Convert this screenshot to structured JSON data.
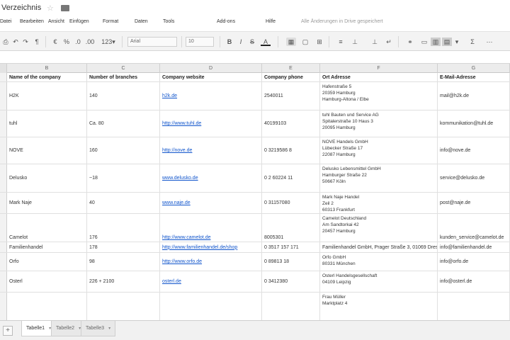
{
  "title": "Verzeichnis",
  "star_icon": "star-icon",
  "folder_icon": "folder-icon",
  "menu": [
    "Datei",
    "Bearbeiten",
    "Ansicht",
    "Einfügen",
    "Format",
    "Daten",
    "Tools",
    "Add-ons",
    "Hilfe"
  ],
  "menu_notice": "Alle Änderungen in Drive gespeichert",
  "toolbar": {
    "font": "Arial",
    "font_size": "10",
    "zoom": "100%"
  },
  "columns": [
    "B",
    "C",
    "D",
    "E",
    "F",
    "G"
  ],
  "headers": [
    "Name of the company",
    "Number of branches",
    "Company website",
    "Company phone",
    "Ort Adresse",
    "E-Mail-Adresse"
  ],
  "rows": [
    {
      "name": "H2K",
      "branches": "140",
      "website": "h2k.de",
      "phone": "2540011",
      "address": [
        "Hafenstraße 5",
        "20359 Hamburg",
        "Hamburg-Altona / Elbe"
      ],
      "email": "mail@h2k.de"
    },
    {
      "name": "tuhl",
      "branches": "Ca. 80",
      "website": "http://www.tuhl.de",
      "phone": "40199103",
      "address": [
        "tuhl Bauten und Service AG",
        "Spitalerstraße 10 Haus 3",
        "20095 Hamburg"
      ],
      "email": "kommunikation@tuhl.de"
    },
    {
      "name": "NOVE",
      "branches": "160",
      "website": "http://nove.de",
      "phone": "0 3219586 8",
      "address": [
        "NOVE Handels GmbH",
        "Lübecker Straße 17",
        "22087 Hamburg"
      ],
      "email": "info@nove.de"
    },
    {
      "name": "Delusko",
      "branches": "~18",
      "website": "www.delusko.de",
      "phone": "0 2 60224 11",
      "address": [
        "Delusko Lebensmittel GmbH",
        "Hamburger Straße 22",
        "50667 Köln"
      ],
      "email": "service@delusko.de"
    },
    {
      "name": "Mark Naje",
      "branches": "40",
      "website": "www.naje.de",
      "phone": "0 31157080",
      "address": [
        "Mark Naje Handel",
        "Zeil 2",
        "60313 Frankfurt"
      ],
      "email": "post@naje.de"
    },
    {
      "name": "Camelot",
      "branches": "176",
      "website": "http://www.camelot.de",
      "phone": "8005301",
      "address": [
        "Camelot Deutschland",
        "Am Sandtorkai 42",
        "20457 Hamburg"
      ],
      "email": "kunden_service@camelot.de"
    },
    {
      "name": "Familienhandel",
      "branches": "178",
      "website": "http://www.familienhandel.de/shop",
      "phone": "0 3517 157 171",
      "address": [
        "Familienhandel GmbH, Prager Straße 3, 01069 Dresden"
      ],
      "email": "info@familienhandel.de"
    },
    {
      "name": "Orfo",
      "branches": "98",
      "website": "http://www.orfo.de",
      "phone": "0 89813 18",
      "address": [
        "Orfo GmbH",
        "80331 München"
      ],
      "email": "info@orfo.de"
    },
    {
      "name": "Osterl",
      "branches": "226 + 2100",
      "website": "osterl.de",
      "phone": "0 3412380",
      "address": [
        "Osterl Handelsgesellschaft",
        "04109 Leipzig"
      ],
      "email": "info@osterl.de"
    },
    {
      "name": "",
      "branches": "",
      "website": "",
      "phone": "",
      "address": [
        "Frau Müller",
        "Marktplatz 4"
      ],
      "email": ""
    }
  ],
  "sheets": [
    "Tabelle1",
    "Tabelle2",
    "Tabelle3"
  ]
}
